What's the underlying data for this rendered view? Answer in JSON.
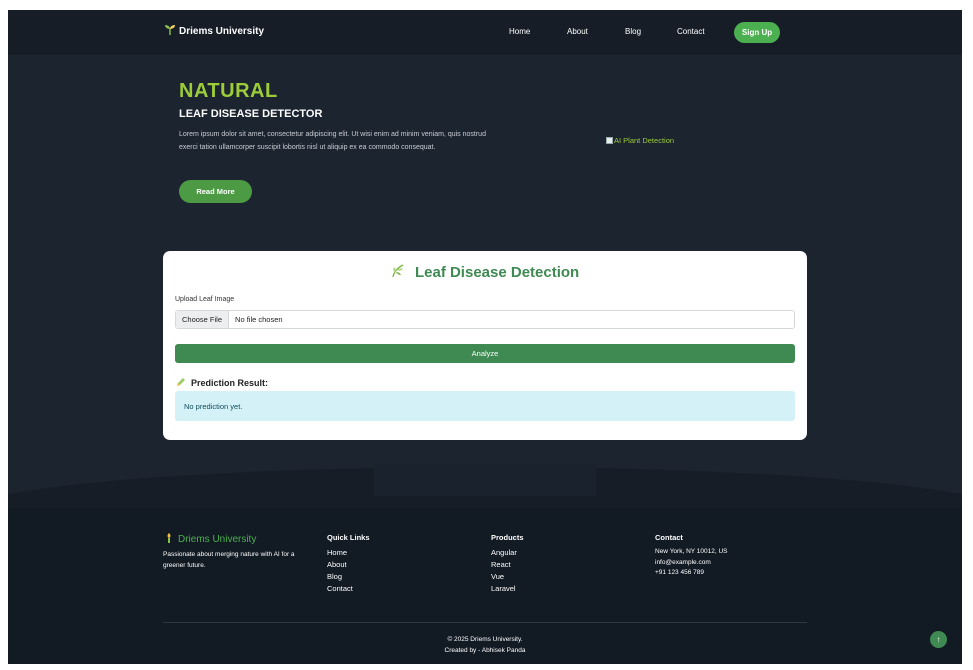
{
  "nav": {
    "brand": "Driems University",
    "brand_icon": "sprout-icon",
    "links": [
      "Home",
      "About",
      "Blog",
      "Contact"
    ],
    "signup": "Sign Up"
  },
  "hero": {
    "title": "NATURAL",
    "subtitle": "LEAF DISEASE DETECTOR",
    "text": "Lorem ipsum dolor sit amet, consectetur adipiscing elit. Ut wisi enim ad minim veniam, quis nostrud exerci tation ullamcorper suscipit lobortis nisl ut aliquip ex ea commodo consequat.",
    "button": "Read More",
    "image_alt": "AI Plant Detection"
  },
  "detector": {
    "title": "Leaf Disease Detection",
    "upload_label": "Upload Leaf Image",
    "file_button": "Choose File",
    "file_status": "No file chosen",
    "analyze": "Analyze",
    "result_heading": "Prediction Result:",
    "result_text": "No prediction yet."
  },
  "footer": {
    "brand": "Driems University",
    "tagline": "Passionate about merging nature with AI for a greener future.",
    "quick_links": {
      "heading": "Quick Links",
      "items": [
        "Home",
        "About",
        "Blog",
        "Contact"
      ]
    },
    "products": {
      "heading": "Products",
      "items": [
        "Angular",
        "React",
        "Vue",
        "Laravel"
      ]
    },
    "contact": {
      "heading": "Contact",
      "items": [
        "New York, NY 10012, US",
        "info@example.com",
        "+91 123 456 789"
      ]
    },
    "copyright": "© 2025 Driems University.",
    "credit": "Created by - Abhisek Panda"
  },
  "colors": {
    "background": "#1c2430",
    "accent_green": "#4caf50",
    "title_green": "#9ccc3a",
    "result_bg": "#d5f1f8"
  }
}
